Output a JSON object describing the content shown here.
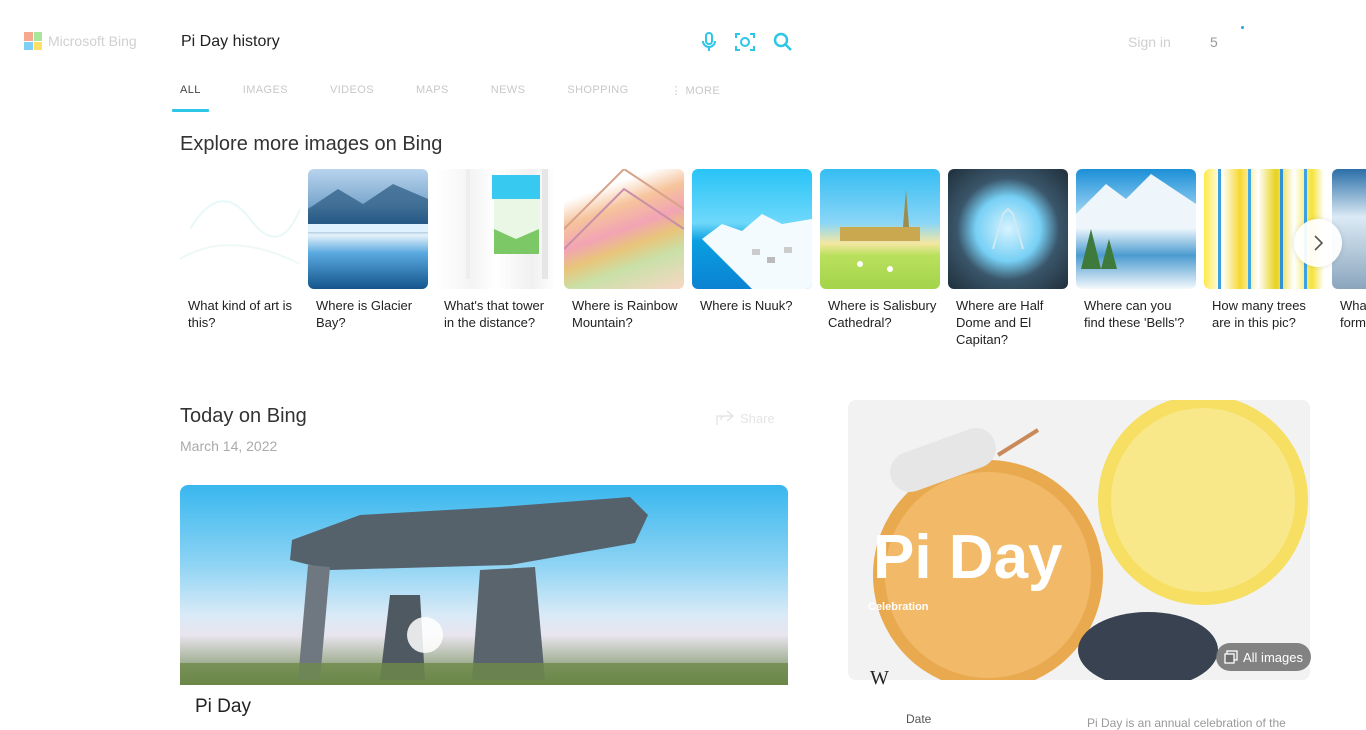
{
  "header": {
    "logo_text": "Microsoft Bing",
    "search_value": "Pi Day history",
    "sign_in": "Sign in",
    "rewards_points": "5",
    "accent": "#2dc6e6"
  },
  "tabs": [
    {
      "label": "ALL",
      "active": true
    },
    {
      "label": "IMAGES"
    },
    {
      "label": "VIDEOS"
    },
    {
      "label": "MAPS"
    },
    {
      "label": "NEWS"
    },
    {
      "label": "SHOPPING"
    },
    {
      "label": "⋮ MORE"
    }
  ],
  "explore": {
    "title": "Explore more images on Bing",
    "cards": [
      {
        "caption": "What kind of art is this?"
      },
      {
        "caption": "Where is Glacier Bay?"
      },
      {
        "caption": "What's that tower in the distance?"
      },
      {
        "caption": "Where is Rainbow Mountain?"
      },
      {
        "caption": "Where is Nuuk?"
      },
      {
        "caption": "Where is Salisbury Cathedral?"
      },
      {
        "caption": "Where are Half Dome and El Capitan?"
      },
      {
        "caption": "Where can you find these 'Bells'?"
      },
      {
        "caption": "How many trees are in this pic?"
      },
      {
        "caption": "What fantastic formation..."
      }
    ]
  },
  "today": {
    "title": "Today on Bing",
    "date": "March 14, 2022",
    "share_label": "Share",
    "hero_caption": "Pi Day",
    "pie_title": "Pi Day",
    "pie_subtitle": "Celebration",
    "all_images": "All images",
    "wiki_logo": "W",
    "date_label": "Date",
    "description": "Pi Day is an annual celebration of the"
  }
}
